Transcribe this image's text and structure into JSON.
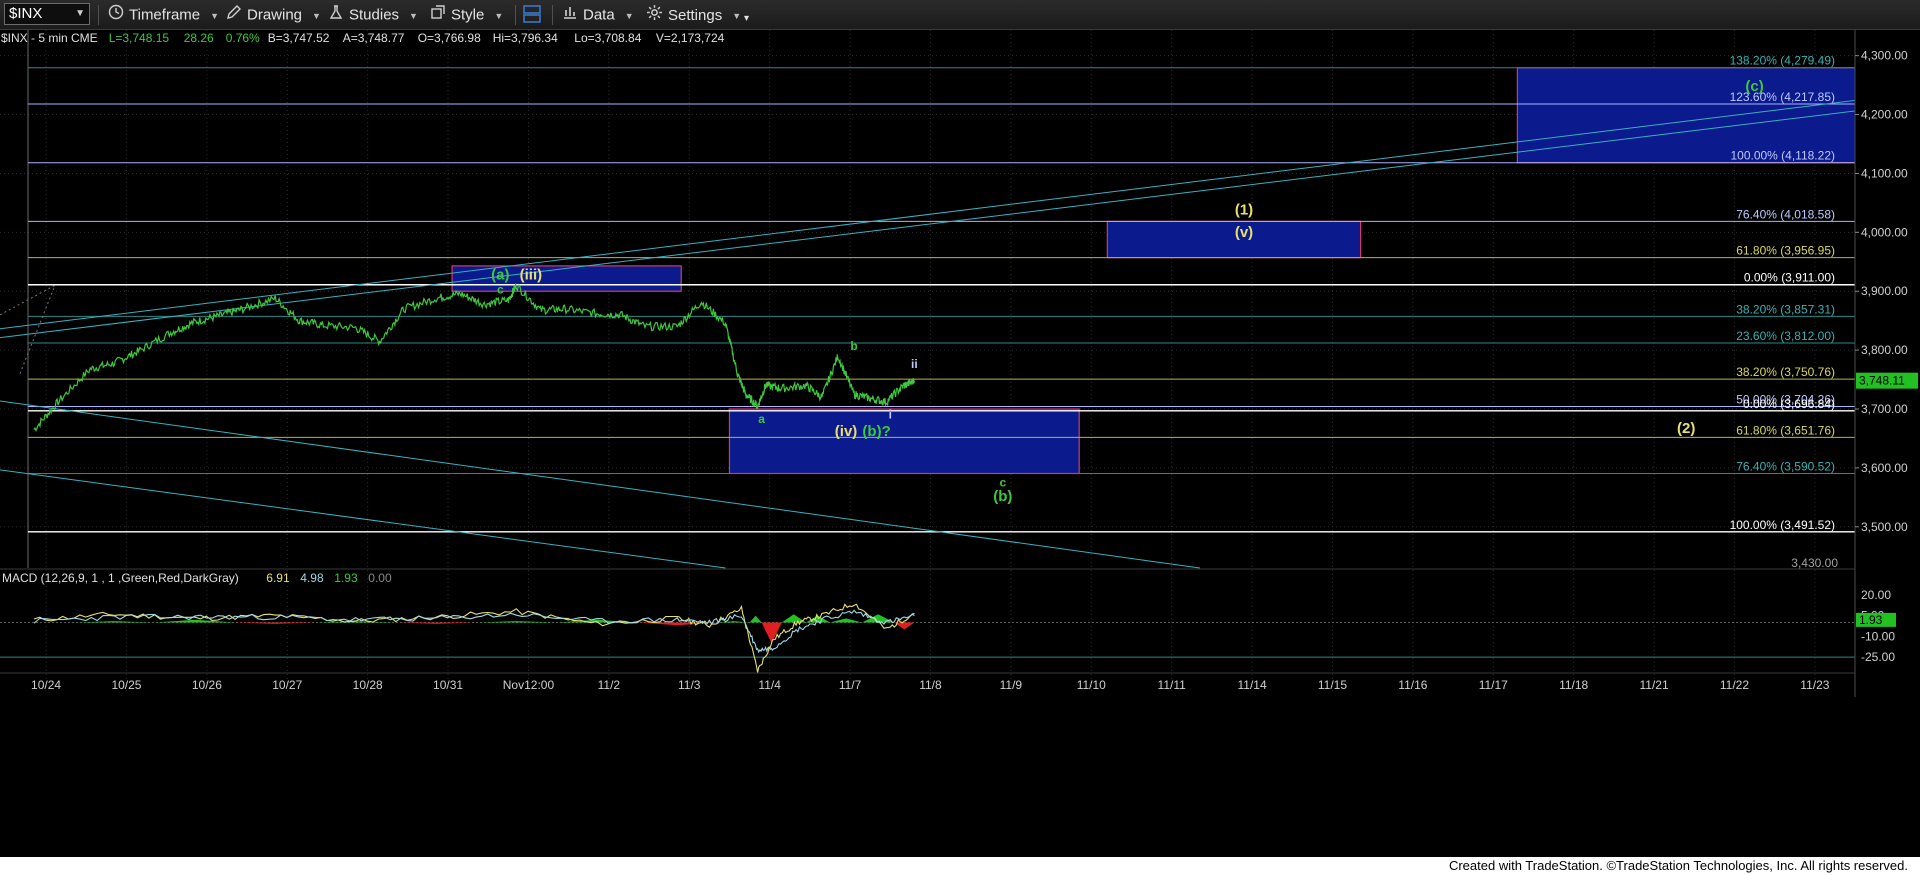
{
  "toolbar": {
    "symbol": "$INX",
    "timeframe_label": "Timeframe",
    "drawing_label": "Drawing",
    "studies_label": "Studies",
    "style_label": "Style",
    "data_label": "Data",
    "settings_label": "Settings"
  },
  "header": {
    "symbol_interval": "$INX - 5 min  CME",
    "stats": [
      {
        "text": "L=3,748.15",
        "color": "#3ec83e"
      },
      {
        "text": "28.26",
        "color": "#3ec83e"
      },
      {
        "text": "0.76%",
        "color": "#3ec83e"
      },
      {
        "text": "B=3,747.52",
        "color": "#e0e0e0"
      },
      {
        "text": "A=3,748.77",
        "color": "#e0e0e0"
      },
      {
        "text": "O=3,766.98",
        "color": "#e0e0e0"
      },
      {
        "text": "Hi=3,796.34",
        "color": "#e0e0e0"
      },
      {
        "text": "Lo=3,708.84",
        "color": "#e0e0e0"
      },
      {
        "text": "V=2,173,724",
        "color": "#e0e0e0"
      }
    ]
  },
  "macd": {
    "label": "MACD (12,26,9, 1 , 1 ,Green,Red,DarkGray)",
    "values": [
      {
        "text": "6.91",
        "color": "#e8e070"
      },
      {
        "text": "4.98",
        "color": "#9fd8e8"
      },
      {
        "text": "1.93",
        "color": "#3ec83e"
      },
      {
        "text": "0.00",
        "color": "#8a8a8a"
      }
    ],
    "ticks": [
      {
        "value": 20,
        "label": "20.00"
      },
      {
        "value": 5,
        "label": "5.00"
      },
      {
        "value": -10,
        "label": "-10.00"
      },
      {
        "value": -25,
        "label": "-25.00"
      }
    ],
    "last_value": 1.93,
    "last_label": "1.93"
  },
  "chart_data": {
    "type": "line",
    "title": "",
    "xlabel": "",
    "ylabel": "",
    "ylim": [
      3430,
      4330
    ],
    "x_ticks": [
      "12:00",
      "10/24",
      "10/25",
      "10/26",
      "10/27",
      "10/28",
      "10/31",
      "Nov12:00",
      "11/2",
      "11/3",
      "11/4",
      "11/7",
      "11/8",
      "11/9",
      "11/10",
      "11/11",
      "11/14",
      "11/15",
      "11/16",
      "11/17",
      "11/18",
      "11/21",
      "11/22",
      "11/23"
    ],
    "y_ticks": [
      {
        "value": 4300,
        "label": "4,300.00"
      },
      {
        "value": 4200,
        "label": "4,200.00"
      },
      {
        "value": 4100,
        "label": "4,100.00"
      },
      {
        "value": 4000,
        "label": "4,000.00"
      },
      {
        "value": 3900,
        "label": "3,900.00"
      },
      {
        "value": 3800,
        "label": "3,800.00"
      },
      {
        "value": 3700,
        "label": "3,700.00"
      },
      {
        "value": 3600,
        "label": "3,600.00"
      },
      {
        "value": 3500,
        "label": "3,500.00"
      }
    ],
    "y_bottom_label": "3,430.00",
    "last_price": 3748.11,
    "last_price_label": "3,748.11",
    "series": [
      {
        "color": "#3ec83e",
        "x": [
          0,
          0.3,
          0.7,
          1.0,
          1.3,
          1.7,
          2.0,
          2.3,
          2.6,
          3.0,
          3.3,
          3.6,
          4.0,
          4.3,
          4.6,
          5.0,
          5.3,
          5.6,
          5.9,
          6.0,
          6.3,
          6.6,
          7.0,
          7.3,
          7.6,
          8.0,
          8.3,
          8.6,
          8.75,
          8.85,
          9.0,
          9.1,
          9.3,
          9.6,
          9.8,
          10.0,
          10.2,
          10.4,
          10.6,
          10.8,
          10.95
        ],
        "y": [
          3665,
          3712,
          3768,
          3778,
          3798,
          3830,
          3848,
          3858,
          3870,
          3888,
          3850,
          3842,
          3838,
          3815,
          3870,
          3888,
          3896,
          3878,
          3885,
          3910,
          3868,
          3870,
          3862,
          3860,
          3840,
          3840,
          3882,
          3845,
          3760,
          3725,
          3705,
          3740,
          3735,
          3740,
          3720,
          3790,
          3725,
          3718,
          3712,
          3738,
          3748
        ]
      }
    ],
    "fib_levels": [
      {
        "pct": "138.20%",
        "value": 4279.49,
        "label": "138.20% (4,279.49)",
        "color": "#2a8a8a",
        "text_color": "#3ab0b0"
      },
      {
        "pct": "123.60%",
        "value": 4217.85,
        "label": "123.60% (4,217.85)",
        "color": "#aab4ff",
        "text_color": "#c0c8ff"
      },
      {
        "pct": "100.00%",
        "value": 4118.22,
        "label": "100.00% (4,118.22)",
        "color": "#aab4ff",
        "text_color": "#c0c8ff"
      },
      {
        "pct": "76.40%",
        "value": 4018.58,
        "label": "76.40% (4,018.58)",
        "color": "#aab4ff",
        "text_color": "#c0c8ff"
      },
      {
        "pct": "61.80%",
        "value": 3956.95,
        "label": "61.80% (3,956.95)",
        "color": "#b5b54a",
        "text_color": "#d8d860"
      },
      {
        "pct": "0.00%",
        "value": 3911.0,
        "label": "0.00% (3,911.00)",
        "color": "#ffffff",
        "text_color": "#ffffff"
      },
      {
        "pct": "38.20%",
        "value": 3857.31,
        "label": "38.20% (3,857.31)",
        "color": "#2a8a8a",
        "text_color": "#3ab0b0"
      },
      {
        "pct": "23.60%",
        "value": 3812.0,
        "label": "23.60% (3,812.00)",
        "color": "#2a8a8a",
        "text_color": "#3ab0b0"
      },
      {
        "pct": "38.20%",
        "value": 3750.76,
        "label": "38.20% (3,750.76)",
        "color": "#b5b54a",
        "text_color": "#d8d860"
      },
      {
        "pct": "50.00%",
        "value": 3704.26,
        "label": "50.00% (3,704.26)",
        "color": "#aab4ff",
        "text_color": "#c0c8ff"
      },
      {
        "pct": "0.00%",
        "value": 3696.84,
        "label": "0.00% (3,696.84)",
        "color": "#ffffff",
        "text_color": "#ffffff"
      },
      {
        "pct": "61.80%",
        "value": 3651.76,
        "label": "61.80% (3,651.76)",
        "color": "#b5b54a",
        "text_color": "#d8d860"
      },
      {
        "pct": "76.40%",
        "value": 3590.52,
        "label": "76.40% (3,590.52)",
        "color": "#2a8a8a",
        "text_color": "#3ab0b0"
      },
      {
        "pct": "100.00%",
        "value": 3491.52,
        "label": "100.00% (3,491.52)",
        "color": "#ffffff",
        "text_color": "#ffffff"
      }
    ],
    "target_boxes": [
      {
        "x0": 5.2,
        "x1": 8.05,
        "y0": 3900,
        "y1": 3943,
        "fill": "#0b1a8c",
        "border": "#d23a6a"
      },
      {
        "x0": 8.65,
        "x1": 13.0,
        "y0": 3590.5,
        "y1": 3700,
        "fill": "#0b1a8c",
        "border": "#d23a6a"
      },
      {
        "x0": 13.35,
        "x1": 16.5,
        "y0": 3957,
        "y1": 4018.6,
        "fill": "#0b1a8c",
        "border": "#d23a6a"
      },
      {
        "x0": 18.45,
        "x1": 23.1,
        "y0": 4118.2,
        "y1": 4279.5,
        "fill": "#0b1a8c",
        "border": "#d23a6a"
      }
    ],
    "trendlines": [
      {
        "x0": -0.5,
        "y0": 3820,
        "x1": 23.6,
        "y1": 4222,
        "color": "#3ab0c0"
      },
      {
        "x0": -0.5,
        "y0": 3835,
        "x1": 23.6,
        "y1": 4240,
        "color": "#3ab0c0"
      },
      {
        "x0": -0.5,
        "y0": 3715,
        "x1": 14.5,
        "y1": 3430,
        "color": "#3ab0c0"
      },
      {
        "x0": -0.5,
        "y0": 3598,
        "x1": 8.6,
        "y1": 3430,
        "color": "#3ab0c0"
      }
    ],
    "annotations": [
      {
        "x": 5.8,
        "y": 3920,
        "text": "(a)",
        "color": "#3ec83e",
        "size": 15
      },
      {
        "x": 6.18,
        "y": 3920,
        "text": "(iii)",
        "color": "#e8e070",
        "size": 15
      },
      {
        "x": 5.8,
        "y": 3896,
        "text": "c",
        "color": "#3ec83e",
        "size": 12
      },
      {
        "x": 9.05,
        "y": 3676,
        "text": "a",
        "color": "#3ec83e",
        "size": 12
      },
      {
        "x": 10.2,
        "y": 3800,
        "text": "b",
        "color": "#3ec83e",
        "size": 12
      },
      {
        "x": 10.95,
        "y": 3770,
        "text": "ii",
        "color": "#c0c8ff",
        "size": 12
      },
      {
        "x": 10.65,
        "y": 3684,
        "text": "i",
        "color": "#c0c8ff",
        "size": 12
      },
      {
        "x": 10.1,
        "y": 3654,
        "text": "(iv)",
        "color": "#e8e070",
        "size": 15
      },
      {
        "x": 10.48,
        "y": 3654,
        "text": "(b)?",
        "color": "#3ec83e",
        "size": 15
      },
      {
        "x": 12.05,
        "y": 3568,
        "text": "c",
        "color": "#3ec83e",
        "size": 12
      },
      {
        "x": 12.05,
        "y": 3544,
        "text": "(b)",
        "color": "#3ec83e",
        "size": 15
      },
      {
        "x": 15.05,
        "y": 4030,
        "text": "(1)",
        "color": "#e8e070",
        "size": 15
      },
      {
        "x": 15.05,
        "y": 3992,
        "text": "(v)",
        "color": "#e8e070",
        "size": 15
      },
      {
        "x": 20.55,
        "y": 3659,
        "text": "(2)",
        "color": "#e8e070",
        "size": 15
      },
      {
        "x": 21.4,
        "y": 4240,
        "text": "(c)",
        "color": "#3ec83e",
        "size": 15
      }
    ],
    "macd_series": {
      "macd": {
        "x": [
          0,
          1,
          2,
          3,
          4,
          5,
          6,
          7,
          8,
          8.4,
          8.8,
          9.0,
          9.2,
          9.5,
          9.8,
          10.2,
          10.6,
          10.95
        ],
        "y": [
          2,
          6,
          3,
          5,
          1,
          4,
          8,
          -1,
          3,
          -2,
          10,
          -35,
          -12,
          0,
          5,
          14,
          -5,
          6.91
        ]
      },
      "signal": {
        "x": [
          0,
          1,
          2,
          3,
          4,
          5,
          6,
          7,
          8,
          8.4,
          8.8,
          9.0,
          9.2,
          9.5,
          9.8,
          10.2,
          10.6,
          10.95
        ],
        "y": [
          1,
          4,
          4,
          4,
          2,
          3,
          6,
          1,
          2,
          0,
          5,
          -20,
          -18,
          -5,
          2,
          8,
          0,
          4.98
        ]
      },
      "histogram": {
        "x": [
          0.5,
          1.5,
          2.5,
          3.5,
          4.5,
          5.5,
          6.5,
          7.5,
          8.5,
          8.9,
          9.05,
          9.3,
          9.6,
          9.9,
          10.3,
          10.7,
          10.95
        ],
        "y": [
          1,
          2,
          -1,
          1,
          -1,
          1,
          2,
          -2,
          1,
          5,
          -15,
          6,
          5,
          3,
          6,
          -5,
          1.93
        ]
      }
    }
  }
}
